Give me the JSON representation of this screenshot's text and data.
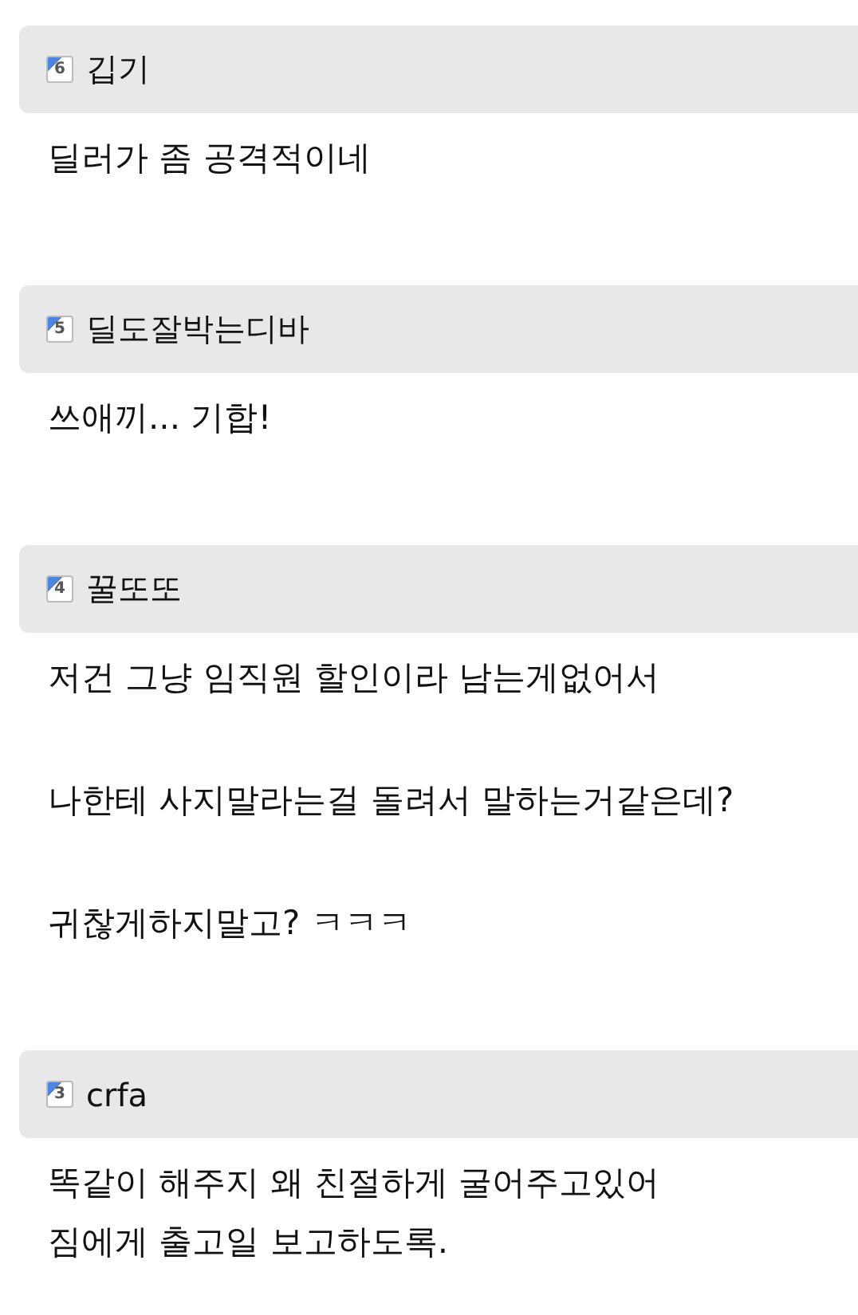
{
  "comments": [
    {
      "level": "6",
      "author": "깁기",
      "paragraphs": [
        [
          "딜러가 좀 공격적이네"
        ]
      ]
    },
    {
      "level": "5",
      "author": "딜도잘박는디바",
      "paragraphs": [
        [
          "쓰애끼... 기합!"
        ]
      ]
    },
    {
      "level": "4",
      "author": "꿀또또",
      "paragraphs": [
        [
          "저건 그냥 임직원 할인이라 남는게없어서"
        ],
        [
          "나한테 사지말라는걸 돌려서 말하는거같은데?"
        ],
        [
          "귀찮게하지말고? ㅋㅋㅋ"
        ]
      ]
    },
    {
      "level": "3",
      "author": "crfa",
      "paragraphs": [
        [
          "똑같이 해주지 왜 친절하게 굴어주고있어",
          "짐에게 출고일 보고하도록."
        ]
      ]
    }
  ]
}
